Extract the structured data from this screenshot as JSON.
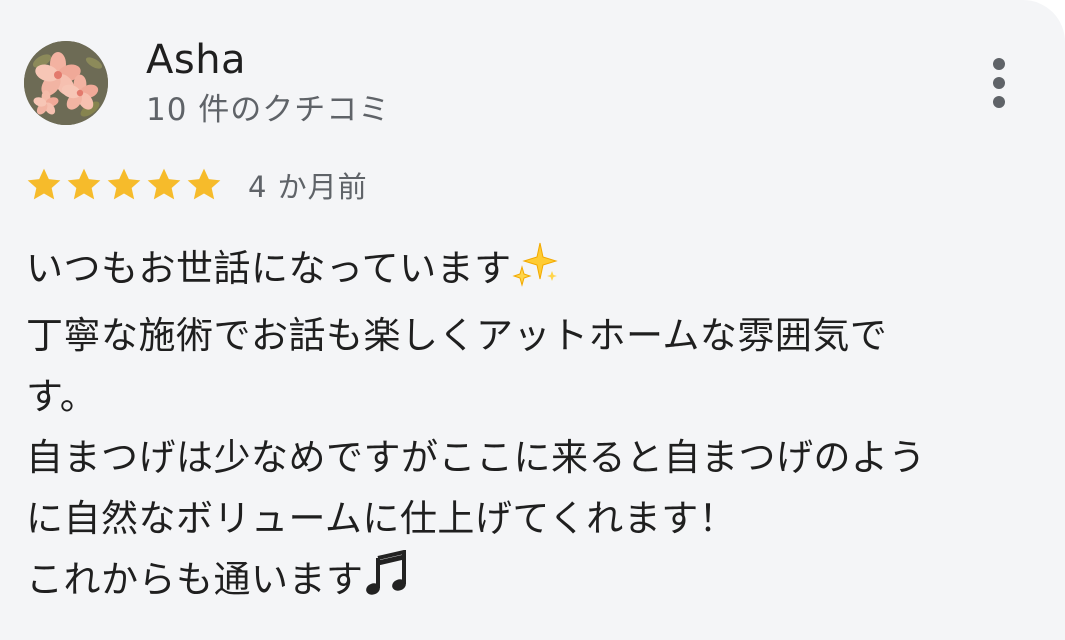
{
  "reviewer": {
    "name": "Asha",
    "review_count": "10 件のクチコミ",
    "avatar_icon": "pink-flowers-avatar"
  },
  "menu": {
    "icon": "more-vert-icon"
  },
  "rating": {
    "stars": 5,
    "max_stars": 5,
    "star_color": "#f6bb2b",
    "time_ago": "4 か月前"
  },
  "review": {
    "lines": [
      "いつもお世話になっています",
      "丁寧な施術でお話も楽しくアットホームな雰囲気で",
      "す。",
      "自まつげは少なめですがここに来ると自まつげのよう",
      "に自然なボリュームに仕上げてくれます！",
      "これからも通います"
    ],
    "emoji": {
      "sparkles": "sparkles-emoji",
      "music": "musical-notes-emoji"
    }
  }
}
